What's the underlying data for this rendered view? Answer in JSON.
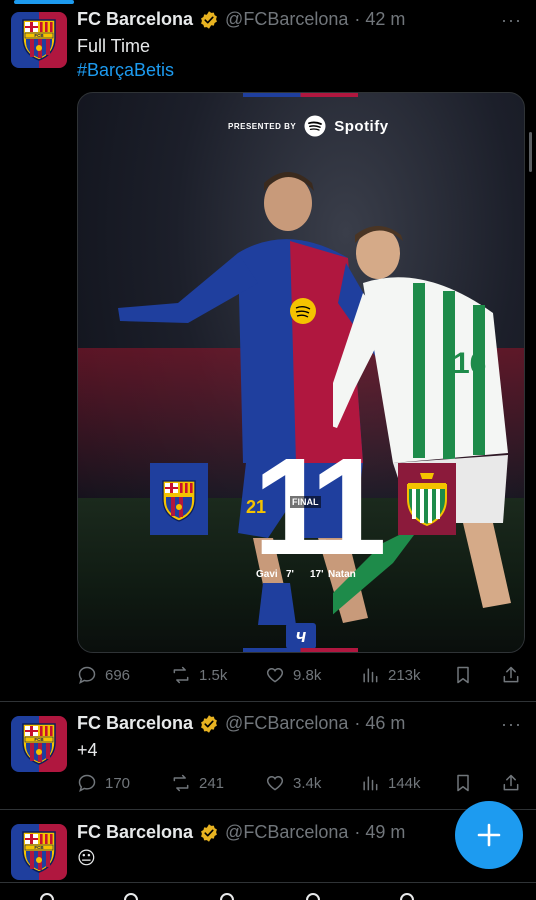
{
  "tweets": [
    {
      "name": "FC Barcelona",
      "handle": "@FCBarcelona",
      "time": "· 42 m",
      "text": "Full Time",
      "hashtag": "#BarçaBetis",
      "media": {
        "presented_by": "PRESENTED BY",
        "sponsor": "Spotify",
        "home_score": "1",
        "away_score": "1",
        "status": "FINAL",
        "home_scorer": "Gavi",
        "home_minute": "7'",
        "away_minute": "17'",
        "away_scorer": "Natan",
        "player_number": "21",
        "away_number": "16"
      },
      "replies": "696",
      "reposts": "1.5k",
      "likes": "9.8k",
      "views": "213k"
    },
    {
      "name": "FC Barcelona",
      "handle": "@FCBarcelona",
      "time": "· 46 m",
      "text": "+4",
      "replies": "170",
      "reposts": "241",
      "likes": "3.4k",
      "views": "144k"
    },
    {
      "name": "FC Barcelona",
      "handle": "@FCBarcelona",
      "time": "· 49 m",
      "text": "😐"
    }
  ],
  "more_label": "···",
  "fab_label": "+",
  "colors": {
    "accent": "#1d9bf0",
    "barca_blue": "#1f3f9e",
    "barca_red": "#b0173f",
    "verified_gold": "#e8b321",
    "muted": "#71767b"
  }
}
